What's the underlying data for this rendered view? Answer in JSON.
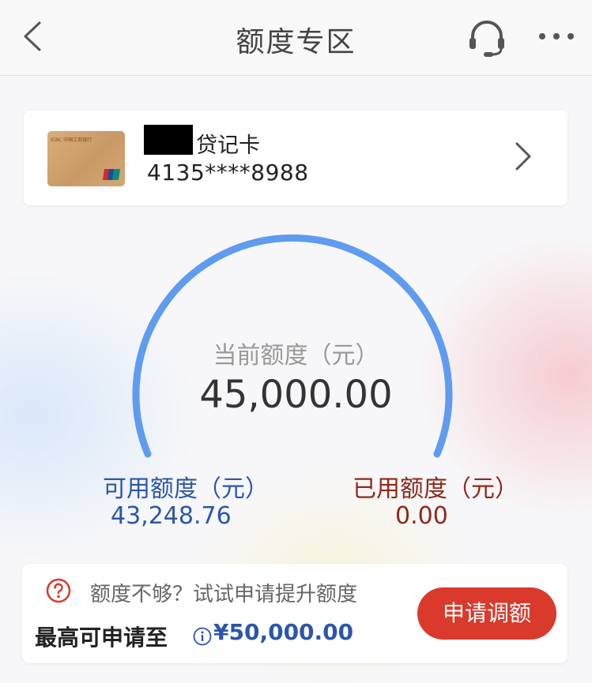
{
  "header": {
    "title": "额度专区",
    "back_icon": "chevron-left-icon",
    "service_icon": "headset-icon",
    "more_icon": "more-horizontal-icon"
  },
  "card": {
    "type_label": "贷记卡",
    "number": "4135****8988",
    "bank_logo_text": "ICBC 中国工商银行",
    "chevron_icon": "chevron-right-icon"
  },
  "limit": {
    "current_label": "当前额度（元）",
    "current_value": "45,000.00",
    "available_label": "可用额度（元）",
    "available_value": "43,248.76",
    "used_label": "已用额度（元）",
    "used_value": "0.00",
    "gauge_color": "#5f9cf0"
  },
  "promo": {
    "hint": "额度不够？试试申请提升额度",
    "max_label": "最高可申请至",
    "max_value": "¥50,000.00",
    "apply_button": "申请调额",
    "button_color": "#d93a2b"
  }
}
